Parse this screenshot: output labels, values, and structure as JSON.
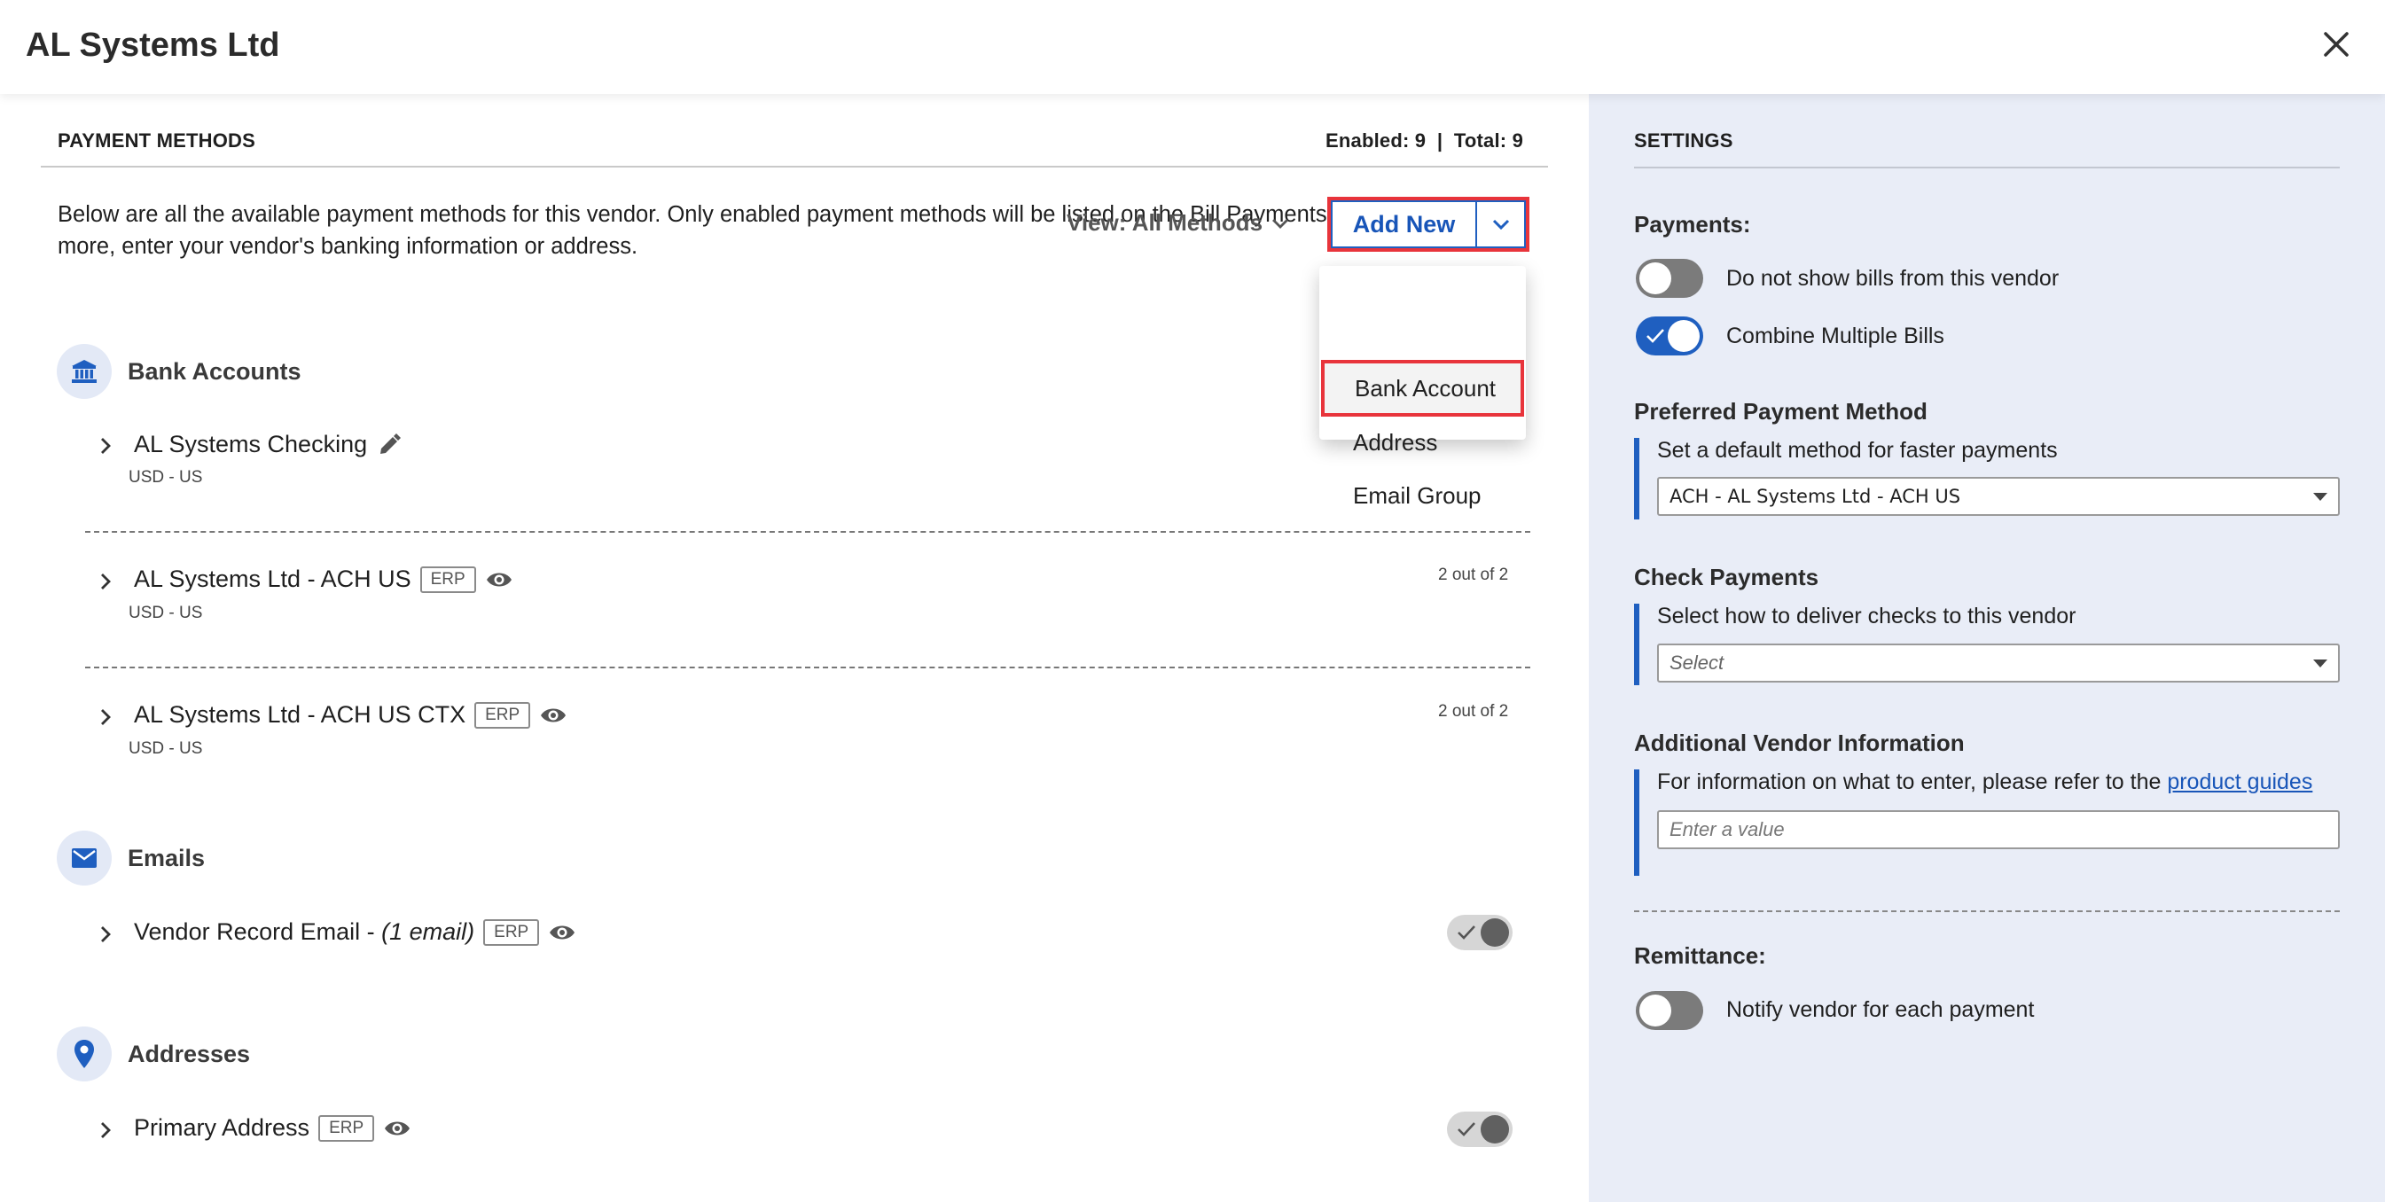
{
  "header": {
    "title": "AL Systems Ltd"
  },
  "payment_methods": {
    "heading": "PAYMENT METHODS",
    "counts": "Enabled: 9  |  Total: 9",
    "description": "Below are all the available payment methods for this vendor. Only enabled payment methods will be listed on the Bill Payments page. To add more, enter your vendor's banking information or address.",
    "view_label": "View: All Methods",
    "add_new_label": "Add New",
    "dropdown": [
      "Bank Account",
      "Address",
      "Email Group"
    ],
    "bank_accounts": {
      "title": "Bank Accounts",
      "rows": [
        {
          "name": "AL Systems Checking",
          "sub": "USD - US",
          "ratio": ""
        },
        {
          "name": "AL Systems Ltd - ACH US",
          "erp": "ERP",
          "sub": "USD - US",
          "ratio": "2 out of 2"
        },
        {
          "name": "AL Systems Ltd - ACH US CTX",
          "erp": "ERP",
          "sub": "USD - US",
          "ratio": "2 out of 2"
        }
      ]
    },
    "emails": {
      "title": "Emails",
      "row": {
        "name": "Vendor Record Email - ",
        "count": "(1 email)",
        "erp": "ERP"
      }
    },
    "addresses": {
      "title": "Addresses",
      "row": {
        "name": "Primary Address",
        "erp": "ERP"
      }
    }
  },
  "settings": {
    "heading": "SETTINGS",
    "payments_label": "Payments:",
    "toggle_hide_bills": "Do not show bills from this vendor",
    "toggle_combine": "Combine Multiple Bills",
    "preferred_label": "Preferred Payment Method",
    "preferred_helper": "Set a default method for faster payments",
    "preferred_value": "ACH - AL Systems Ltd - ACH US",
    "check_label": "Check Payments",
    "check_helper": "Select how to deliver checks to this vendor",
    "check_placeholder": "Select",
    "additional_label": "Additional Vendor Information",
    "additional_helper": "For information on what to enter, please refer to the ",
    "additional_link": "product guides",
    "additional_placeholder": "Enter a value",
    "remittance_label": "Remittance:",
    "toggle_notify": "Notify vendor for each payment"
  },
  "colors": {
    "accent": "#1f5fc0",
    "highlight": "#e8343b",
    "panel": "#e9edf7"
  }
}
